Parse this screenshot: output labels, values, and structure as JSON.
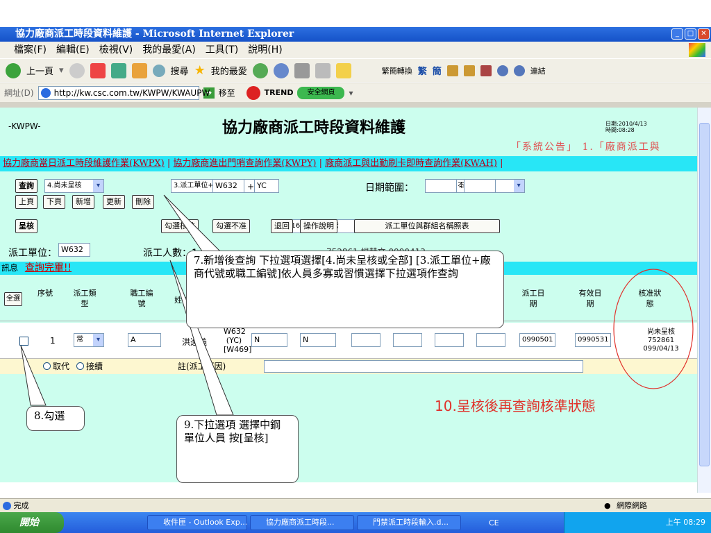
{
  "window": {
    "title": "協力廠商派工時段資料維護 - Microsoft Internet Explorer"
  },
  "menu": [
    "檔案(F)",
    "編輯(E)",
    "檢視(V)",
    "我的最愛(A)",
    "工具(T)",
    "說明(H)"
  ],
  "toolbar": {
    "back": "上一頁",
    "search": "搜尋",
    "favorites": "我的最愛",
    "trans": "繁簡轉換",
    "trad": "繁",
    "simp": "簡",
    "connect": "連結"
  },
  "address": {
    "label": "網址(D)",
    "url": "http://kw.csc.com.tw/KWPW/KWAUPW",
    "go": "移至",
    "trend": "TREND",
    "safe": "安全網頁"
  },
  "page": {
    "code": "-KWPW-",
    "title": "協力廠商派工時段資料維護",
    "date": "日期:2010/4/13",
    "time": "時間:08:28",
    "notice": "「系統公告」 1.「廠商派工與",
    "links": [
      "協力廠商當日派工時段維護作業(KWPX)",
      "協力廠商進出門哨查詢作業(KWPY)",
      "廠商派工與出勤刷卡即時查詢作業(KWAH)"
    ],
    "row1": {
      "query": "查詢",
      "sel_status": "4.尚未呈核",
      "sel_type": "3.派工單位+廠商代號",
      "unit": "W632",
      "plus": "+",
      "vendor": "YC",
      "sel_date": "2.不指定日期",
      "range_label": "日期範圍：",
      "tilde": "~"
    },
    "row2": [
      "上頁",
      "下頁",
      "新增",
      "更新",
      "刪除"
    ],
    "row3": {
      "submit": "呈核",
      "person": "162677陳淯騰",
      "check": "勾選核准",
      "check2": "勾選不准",
      "back": "退回",
      "help": "操作說明",
      "mapping": "派工單位與群組名稱照表"
    },
    "row4": {
      "unit_label": "派工單位：",
      "unit": "W632",
      "count_label": "派工人數：1 人",
      "extra": "752861 楊慧文 0990413"
    },
    "msg": {
      "label": "訊息",
      "text": "查詢完畢!!"
    },
    "headers": {
      "sel": "全選",
      "seq": "序號",
      "type": "派工類型",
      "emp": "職工編號",
      "name": "姓名",
      "date": "派工日期",
      "valid": "有效日期",
      "status": "核准狀態"
    },
    "data": {
      "seq": "1",
      "type": "常",
      "emp": "A",
      "name": "洪進義",
      "unit": "W632 (YC) [W469]",
      "c1": "N",
      "c2": "N",
      "date": "0990501",
      "valid": "0990531",
      "status1": "尚未呈核",
      "status2": "752861",
      "status3": "099/04/13"
    },
    "sub": {
      "opt1": "取代",
      "opt2": "接續",
      "remark": "註(派工原因)"
    }
  },
  "callouts": {
    "c7": "7.新增後查詢 下拉選項選擇[4.尚未呈核或全部] [3.派工單位+廠商代號或職工編號]依人員多寡或習慣選擇下拉選項作查詢",
    "c8": "8.勾選",
    "c9": "9.下拉選項 選擇中鋼單位人員 按[呈核]",
    "c10": "10.呈核後再查詢核準狀態"
  },
  "status": {
    "done": "完成",
    "zone": "網際網路"
  },
  "taskbar": {
    "start": "開始",
    "tasks": [
      "收件匣 - Outlook Exp...",
      "協力廠商派工時段...",
      "門禁派工時段輸入.d..."
    ],
    "lang": "CE",
    "clock": "上午 08:29"
  }
}
